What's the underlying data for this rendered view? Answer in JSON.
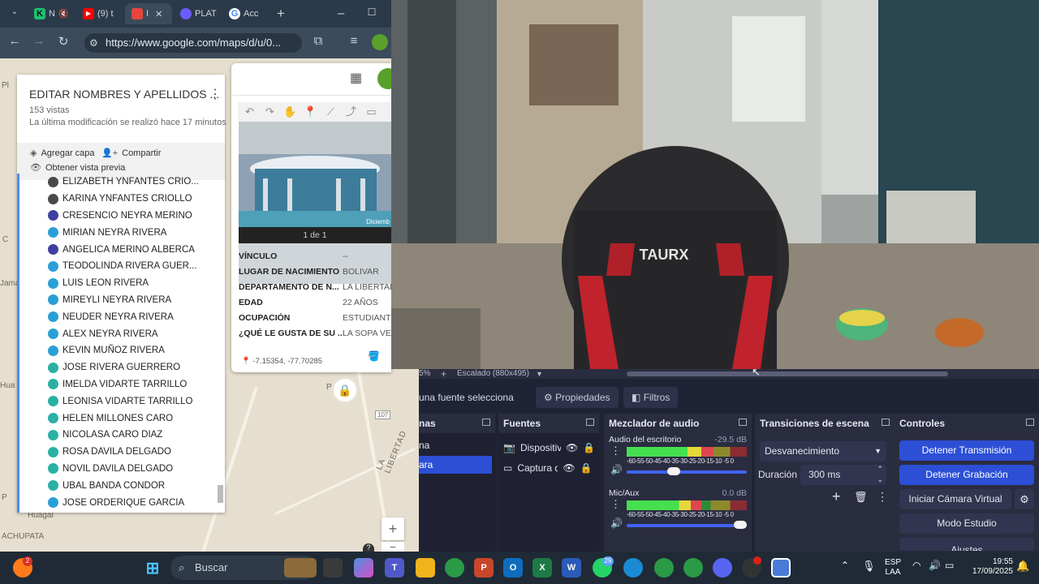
{
  "browser": {
    "tabs": [
      {
        "label": "N",
        "color": "#1dbf73",
        "glyph": "K"
      },
      {
        "label": "(9) t",
        "color": "#ff0000",
        "glyph": "▶"
      },
      {
        "label": "I",
        "color": "#e8453c",
        "glyph": "◉"
      },
      {
        "label": "PLAT",
        "color": "#6b5cff",
        "glyph": "◐"
      },
      {
        "label": "Acc",
        "color": "#4285f4",
        "glyph": "G"
      }
    ],
    "url": "https://www.google.com/maps/d/u/0..."
  },
  "map": {
    "labels": [
      "Pl",
      "Jamal",
      "Hua",
      "C",
      "ACHUPATA",
      "Huagal",
      "LA LIBERTAD",
      "107",
      "P",
      "P"
    ],
    "zoom_in": "+",
    "zoom_out": "−"
  },
  "layer_panel": {
    "title": "EDITAR NOMBRES Y APELLIDOS ...",
    "views": "153 vistas",
    "last_modified": "La última modificación se realizó hace 17 minutos",
    "add_layer": "Agregar capa",
    "share": "Compartir",
    "preview": "Obtener vista previa",
    "people": [
      {
        "name": "ELIZABETH YNFANTES CRIO...",
        "color": "#4a4a4a"
      },
      {
        "name": "KARINA YNFANTES CRIOLLO",
        "color": "#4a4a4a"
      },
      {
        "name": "CRESENCIO NEYRA MERINO",
        "color": "#3f3fa0"
      },
      {
        "name": "MIRIAN NEYRA RIVERA",
        "color": "#2a9fd6"
      },
      {
        "name": "ANGELICA MERINO ALBERCA",
        "color": "#3f3fa0"
      },
      {
        "name": "TEODOLINDA RIVERA GUER...",
        "color": "#2a9fd6"
      },
      {
        "name": "LUIS LEON RIVERA",
        "color": "#2a9fd6"
      },
      {
        "name": "MIREYLI NEYRA RIVERA",
        "color": "#2a9fd6"
      },
      {
        "name": "NEUDER NEYRA RIVERA",
        "color": "#2a9fd6"
      },
      {
        "name": "ALEX NEYRA RIVERA",
        "color": "#2a9fd6"
      },
      {
        "name": "KEVIN MUÑOZ RIVERA",
        "color": "#2a9fd6"
      },
      {
        "name": "JOSE RIVERA GUERRERO",
        "color": "#2ab0a5"
      },
      {
        "name": "IMELDA VIDARTE TARRILLO",
        "color": "#2ab0a5"
      },
      {
        "name": "LEONISA VIDARTE TARRILLO",
        "color": "#2ab0a5"
      },
      {
        "name": "HELEN MILLONES CARO",
        "color": "#2ab0a5"
      },
      {
        "name": "NICOLASA CARO DIAZ",
        "color": "#2ab0a5"
      },
      {
        "name": "ROSA DAVILA DELGADO",
        "color": "#2ab0a5"
      },
      {
        "name": "NOVIL DAVILA DELGADO",
        "color": "#2ab0a5"
      },
      {
        "name": "UBAL BANDA CONDOR",
        "color": "#2ab0a5"
      },
      {
        "name": "JOSE ORDERIQUE GARCIA",
        "color": "#2a9fd6"
      }
    ]
  },
  "info_card": {
    "photo_caption": "1 de 1",
    "photo_date": "Diciemb",
    "fields": [
      {
        "key": "VÍNCULO",
        "value": "--"
      },
      {
        "key": "LUGAR DE NACIMIENTO",
        "value": "BOLIVAR"
      },
      {
        "key": "DEPARTAMENTO DE N...",
        "value": "LA LIBERTAD"
      },
      {
        "key": "EDAD",
        "value": "22 AÑOS"
      },
      {
        "key": "OCUPACIÓN",
        "value": "ESTUDIANTE"
      },
      {
        "key": "¿QUÉ LE GUSTA DE SU ...",
        "value": "LA SOPA VER"
      }
    ],
    "coordinates": "-7.15354, -77.70285"
  },
  "webcam": {
    "chair_brand": "TAURX"
  },
  "obs": {
    "zoom_pct": "5%",
    "zoom_plus": "+",
    "scaling": "Escalado (880x495)",
    "no_source_msg": "una fuente selecciona",
    "properties": "Propiedades",
    "filters": "Filtros",
    "scenes_title": "nas",
    "scenes": [
      "na",
      "ara"
    ],
    "sources_title": "Fuentes",
    "sources": [
      "Dispositiv",
      "Captura d"
    ],
    "mixer_title": "Mezclador de audio",
    "mixer": [
      {
        "name": "Audio del escritorio",
        "db": "-29.5 dB",
        "level": 0.72,
        "volume": 0.38
      },
      {
        "name": "Mic/Aux",
        "db": "0.0 dB",
        "level": 0.62,
        "volume": 1.0
      }
    ],
    "meter_scale": "-60-55-50-45-40-35-30-25-20-15-10 -5  0",
    "transitions_title": "Transiciones de escena",
    "transition": "Desvanecimiento",
    "duration_label": "Duración",
    "duration_value": "300 ms",
    "controls_title": "Controles",
    "controls": [
      "Detener Transmisión",
      "Detener Grabación",
      "Iniciar Cámara Virtual",
      "Modo Estudio",
      "Ajustes"
    ]
  },
  "taskbar": {
    "search_placeholder": "Buscar",
    "badge_firefox": "2",
    "badge_whatsapp": "29",
    "lang_top": "ESP",
    "lang_bottom": "LAA",
    "time": "19:55",
    "date": "17/09/2025"
  }
}
